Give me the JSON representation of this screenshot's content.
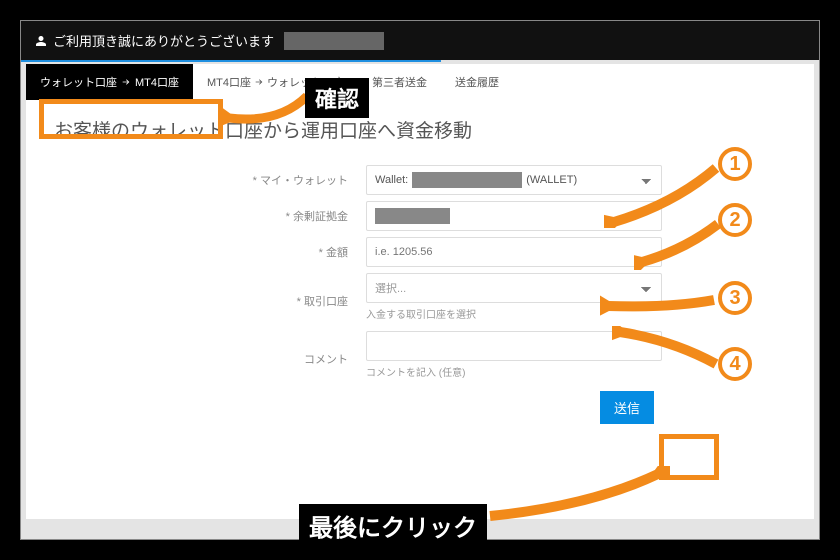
{
  "header": {
    "greeting": "ご利用頂き誠にありがとうございます"
  },
  "tabs": {
    "t1a": "ウォレット口座",
    "t1b": "MT4口座",
    "t2a": "MT4口座",
    "t2b": "ウォレット口座",
    "t3": "第三者送金",
    "t4": "送金履歴"
  },
  "page": {
    "title": "お客様のウォレット口座から運用口座へ資金移動"
  },
  "form": {
    "wallet_label": "* マイ・ウォレット",
    "wallet_prefix": "Wallet:",
    "wallet_suffix": "(WALLET)",
    "balance_label": "* 余剰証拠金",
    "amount_label": "* 金額",
    "amount_placeholder": "i.e. 1205.56",
    "account_label": "* 取引口座",
    "account_placeholder": "選択...",
    "account_help": "入金する取引口座を選択",
    "comment_label": "コメント",
    "comment_help": "コメントを記入 (任意)",
    "submit": "送信"
  },
  "annotations": {
    "confirm": "確認",
    "final_click": "最後にクリック",
    "n1": "1",
    "n2": "2",
    "n3": "3",
    "n4": "4"
  }
}
